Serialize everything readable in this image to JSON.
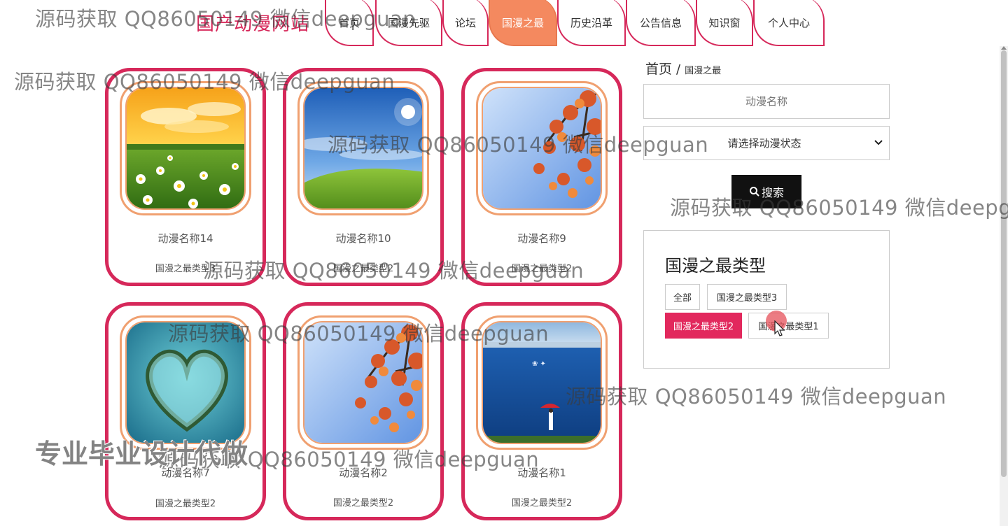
{
  "site": {
    "logo": "国产动漫网站"
  },
  "nav": [
    {
      "label": "首页"
    },
    {
      "label": "国漫先驱"
    },
    {
      "label": "论坛"
    },
    {
      "label": "国漫之最",
      "active": true
    },
    {
      "label": "历史沿革"
    },
    {
      "label": "公告信息"
    },
    {
      "label": "知识窗"
    },
    {
      "label": "个人中心"
    }
  ],
  "cards": [
    {
      "name": "动漫名称14",
      "type": "国漫之最类型3",
      "image": "daisy-sunset-field"
    },
    {
      "name": "动漫名称10",
      "type": "国漫之最类型2",
      "image": "green-hill-blue-sky"
    },
    {
      "name": "动漫名称9",
      "type": "国漫之最类型2",
      "image": "autumn-maple-sky"
    },
    {
      "name": "",
      "type": "",
      "image": "heart-island-sea"
    },
    {
      "name": "动漫名称2",
      "type": "国漫之最类型2",
      "image": "autumn-maple-sky"
    },
    {
      "name": "动漫名称1",
      "type": "国漫之最类型2",
      "image": "girl-red-umbrella-lake"
    }
  ],
  "card_overlay_text": [
    "动漫名称7",
    "国漫之最类型2"
  ],
  "breadcrumb": {
    "home": "首页",
    "separator": "/",
    "current": "国漫之最"
  },
  "search": {
    "name_placeholder": "动漫名称",
    "status_value": "请选择动漫状态",
    "button_label": "搜索"
  },
  "type_panel": {
    "title": "国漫之最类型",
    "tags": [
      {
        "label": "全部"
      },
      {
        "label": "国漫之最类型3"
      },
      {
        "label": "国漫之最类型2",
        "active": true
      },
      {
        "label": "国漫之最类型1"
      }
    ]
  },
  "watermark": {
    "text": "源码获取 QQ86050149 微信deepguan",
    "text_cut": "源码获取 QQ86050149 微信deepg",
    "big": "专业毕业设计代做"
  },
  "colors": {
    "accent": "#d6285a",
    "nav_active": "#f4895f",
    "frame": "#f0a070",
    "tag_active": "#e2285d",
    "button": "#111111"
  }
}
